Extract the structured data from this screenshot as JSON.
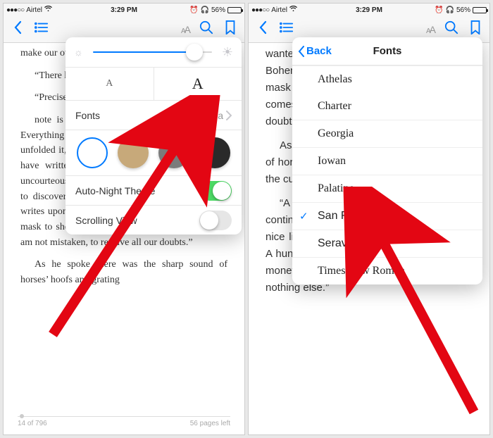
{
  "statusbar": {
    "carrier": "Airtel",
    "time": "3:29 PM",
    "battery_pct": "56%"
  },
  "left": {
    "book_text": {
      "p1": "make our own little deduction cloud from which we",
      "p2": "“There has been a scandal in Bohemia",
      "p3": "“Precisely so. But how did you wrote to me",
      "p4": "note is undated, has no signature or address. Everything about the sentence is German. He unfolded it, and from anyone of Russian would not have written that. It is the German who is so uncourteous to his verbs. It only remains, therefore, to discover what is wanted by this German who writes upon Bohemian paper and prefers wearing a mask to showing his face. And here he comes, if I am not mistaken, to resolve all our doubts.”",
      "p5": "As he spoke there was the sharp sound of horses’ hoofs and grating"
    },
    "popover": {
      "fonts_label": "Fonts",
      "fonts_value": "Georgia",
      "autonight_label": "Auto-Night Theme",
      "scrolling_label": "Scrolling View"
    },
    "footer": {
      "page": "14 of 796",
      "left": "56 pages left"
    }
  },
  "right": {
    "book_text": {
      "p1": "wanted to be this German who writes upon Bohemian paper and prefers wearing a mask to showing his face. And here he comes, if I am not mistaken, resolve all our doubts.”",
      "p2": "As he spoke there was the sharp sound of horses’ hoofs and grating wheels against the curb, followed by a sharp",
      "p3": "“A pair, by the sound,” said he. “Yes,” he continued, glancing out of the window. “A nice little brougham and a pair of beauties. A hundred and fifty guineas apiece. There’s money in this case, Watson, if there is nothing else.”"
    },
    "popover": {
      "back": "Back",
      "title": "Fonts",
      "fonts": [
        "Athelas",
        "Charter",
        "Georgia",
        "Iowan",
        "Palatino",
        "San Francisco",
        "Seravek",
        "Times New Roman"
      ],
      "selected_index": 5
    }
  }
}
